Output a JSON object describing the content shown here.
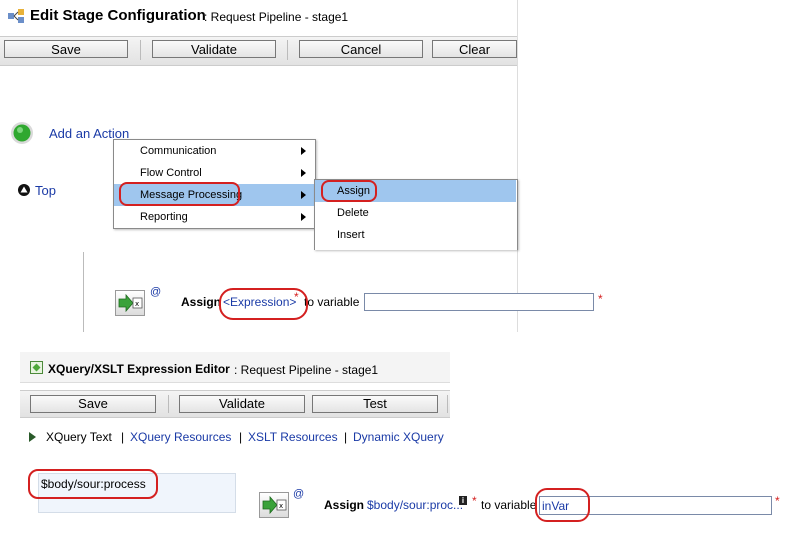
{
  "stage_editor": {
    "title": "Edit Stage Configuration",
    "subtitle": ": Request Pipeline - stage1",
    "buttons": {
      "save": "Save",
      "validate": "Validate",
      "cancel": "Cancel",
      "clear": "Clear"
    },
    "add_action": "Add an Action",
    "top_link": "Top",
    "context_menu": {
      "items": [
        "Communication",
        "Flow Control",
        "Message Processing",
        "Reporting"
      ],
      "submenu": [
        "Assign",
        "Delete",
        "Insert"
      ]
    },
    "assign_row": {
      "at": "@",
      "label": "Assign",
      "expression": "<Expression>",
      "to_variable": "to variable",
      "variable_value": "",
      "required": "*"
    }
  },
  "xquery_editor": {
    "title": "XQuery/XSLT Expression Editor",
    "subtitle": ": Request Pipeline - stage1",
    "buttons": {
      "save": "Save",
      "validate": "Validate",
      "test": "Test"
    },
    "tabs": [
      "XQuery Text",
      "XQuery Resources",
      "XSLT Resources",
      "Dynamic XQuery"
    ],
    "tab_separator": "|",
    "expression_text": "$body/sour:process"
  },
  "assign_result": {
    "at": "@",
    "label": "Assign",
    "expression": "$body/sour:proc...",
    "info": "i",
    "to_variable": "to variable",
    "variable_value": "inVar",
    "required": "*"
  },
  "colors": {
    "accent_link": "#1a3aa6",
    "highlight": "#9fc6ee",
    "annotation_red": "#d42020",
    "status_green": "#2fa82f"
  }
}
